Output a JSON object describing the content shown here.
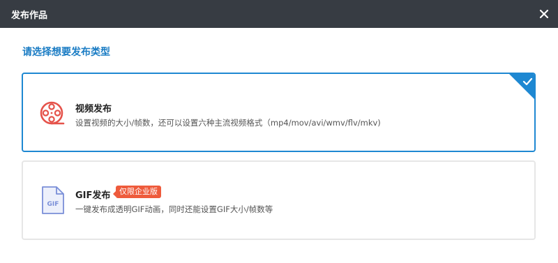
{
  "dialog": {
    "title": "发布作品",
    "prompt": "请选择想要发布类型"
  },
  "options": [
    {
      "name": "视频发布",
      "description": "设置视频的大小/帧数，还可以设置六种主流视频格式（mp4/mov/avi/wmv/flv/mkv)",
      "icon": "film-reel-icon",
      "selected": true
    },
    {
      "name": "GIF发布",
      "badge": "仅限企业版",
      "description": "一键发布成透明GIF动画，同时还能设置GIF大小/帧数等",
      "icon": "gif-file-icon",
      "icon_text": "GIF",
      "selected": false
    }
  ],
  "colors": {
    "titlebar": "#373c43",
    "accent": "#1e88d2",
    "badge": "#ee5b3c",
    "video_icon": "#e5534b",
    "gif_icon": "#7a8fd8"
  }
}
